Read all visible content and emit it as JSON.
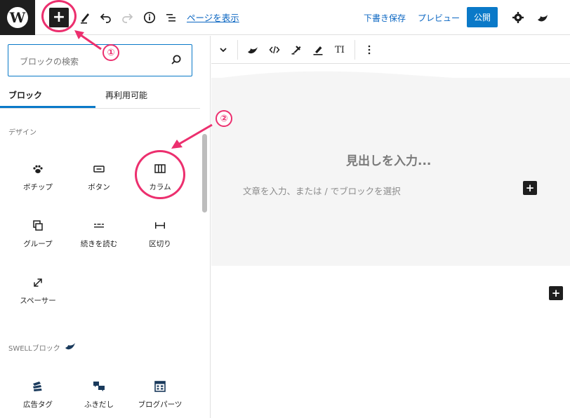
{
  "topbar": {
    "add_label": "+",
    "view_page": "ページを表示",
    "save_draft": "下書き保存",
    "preview": "プレビュー",
    "publish": "公開",
    "wp_logo_letter": "W"
  },
  "panel": {
    "search_placeholder": "ブロックの検索",
    "tabs": [
      {
        "label": "ブロック",
        "active": true
      },
      {
        "label": "再利用可能",
        "active": false
      }
    ],
    "sections": [
      {
        "label": "デザイン",
        "blocks": [
          {
            "label": "ボチップ",
            "icon": "paw-icon"
          },
          {
            "label": "ボタン",
            "icon": "button-icon"
          },
          {
            "label": "カラム",
            "icon": "columns-icon"
          },
          {
            "label": "グループ",
            "icon": "group-icon"
          },
          {
            "label": "続きを読む",
            "icon": "more-icon"
          },
          {
            "label": "区切り",
            "icon": "separator-icon"
          },
          {
            "label": "スペーサー",
            "icon": "spacer-icon"
          }
        ]
      },
      {
        "label": "SWELLブロック",
        "blocks": [
          {
            "label": "広告タグ",
            "icon": "ad-tag-icon"
          },
          {
            "label": "ふきだし",
            "icon": "speech-bubble-icon"
          },
          {
            "label": "ブログパーツ",
            "icon": "blog-parts-icon"
          }
        ]
      }
    ]
  },
  "editor": {
    "toolbar_text_icon": "TI",
    "heading_placeholder": "見出しを入力...",
    "paragraph_placeholder": "文章を入力、または / でブロックを選択",
    "add_label": "+"
  },
  "annotations": [
    {
      "number": "①"
    },
    {
      "number": "②"
    }
  ],
  "colors": {
    "accent": "#0a79c8",
    "annotation": "#ec2f6e",
    "dark": "#1e1e1e"
  }
}
